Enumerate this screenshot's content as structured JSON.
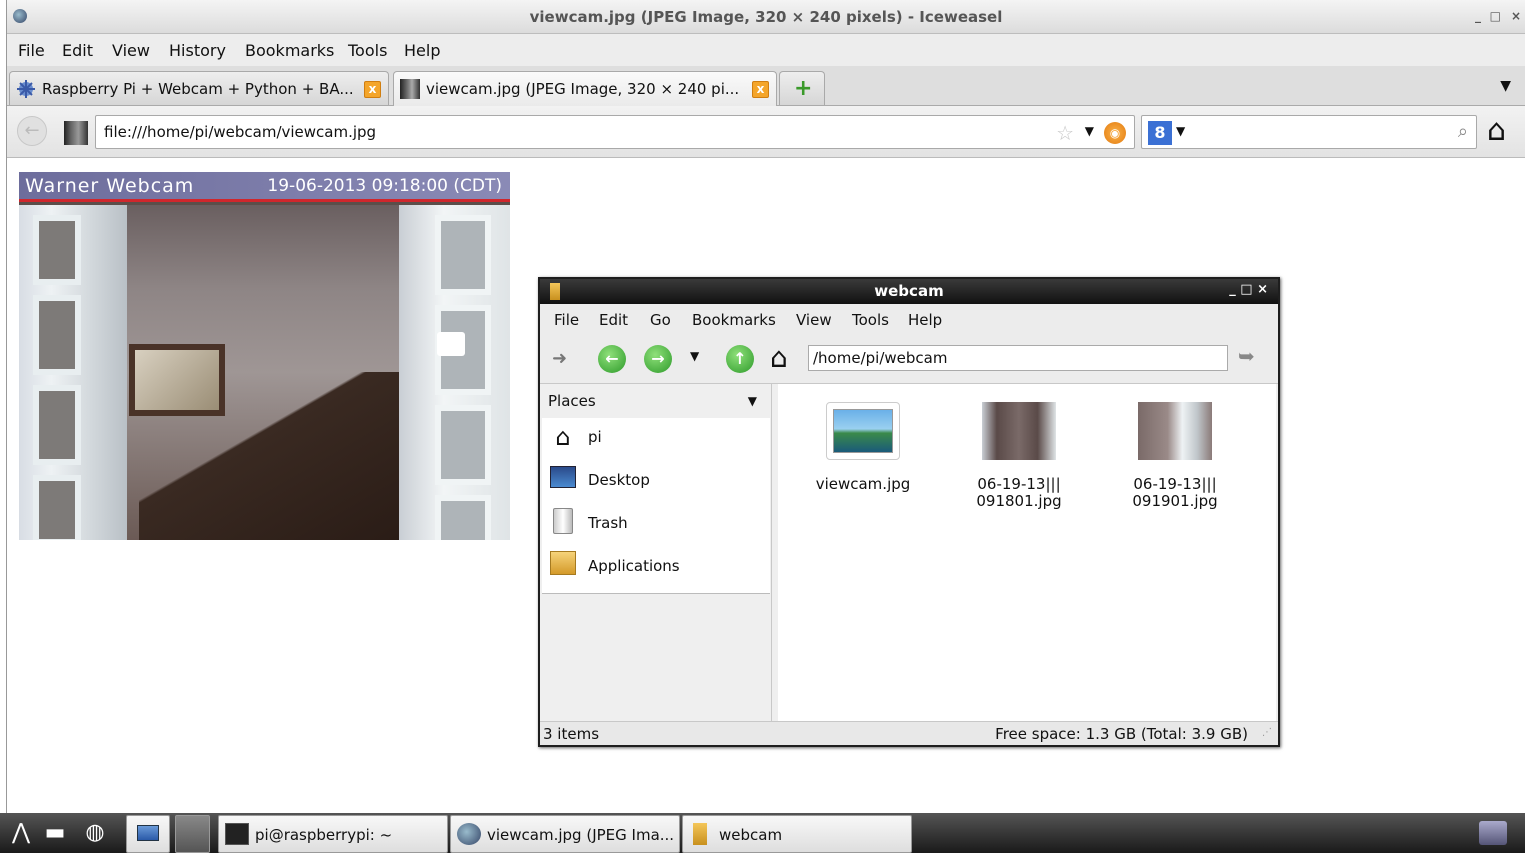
{
  "window": {
    "title": "viewcam.jpg (JPEG Image, 320 × 240 pixels) - Iceweasel",
    "min": "_",
    "max": "□",
    "close": "×"
  },
  "menubar": {
    "file": "File",
    "edit": "Edit",
    "view": "View",
    "history": "History",
    "bookmarks": "Bookmarks",
    "tools": "Tools",
    "help": "Help"
  },
  "tabs": [
    {
      "label": "Raspberry Pi + Webcam + Python + BA...",
      "close": "x"
    },
    {
      "label": "viewcam.jpg (JPEG Image, 320 × 240 pi...",
      "close": "x"
    }
  ],
  "newtab": "+",
  "tablist": "▼",
  "navbar": {
    "back": "←",
    "url": "file:///home/pi/webcam/viewcam.jpg",
    "star": "☆",
    "url_drop": "▼",
    "search_engine": "8",
    "search_drop": "▼",
    "home": "⌂"
  },
  "image": {
    "overlay_title": "Warner Webcam",
    "overlay_date": "19-06-2013 09:18:00 (CDT)"
  },
  "filemanager": {
    "title": "webcam",
    "controls": "_ □ ×",
    "menu": {
      "file": "File",
      "edit": "Edit",
      "go": "Go",
      "bookmarks": "Bookmarks",
      "view": "View",
      "tools": "Tools",
      "help": "Help"
    },
    "path": "/home/pi/webcam",
    "places_label": "Places",
    "places": [
      {
        "label": "pi",
        "icon": "home-icon"
      },
      {
        "label": "Desktop",
        "icon": "desktop-icon"
      },
      {
        "label": "Trash",
        "icon": "trash-icon"
      },
      {
        "label": "Applications",
        "icon": "applications-icon"
      }
    ],
    "files": [
      {
        "line1": "viewcam.jpg",
        "line2": ""
      },
      {
        "line1": "06-19-13|||",
        "line2": "091801.jpg"
      },
      {
        "line1": "06-19-13|||",
        "line2": "091901.jpg"
      }
    ],
    "status_left": "3 items",
    "status_right": "Free space: 1.3 GB (Total: 3.9 GB)"
  },
  "taskbar": {
    "items": [
      {
        "label": "pi@raspberrypi: ~"
      },
      {
        "label": "viewcam.jpg (JPEG Ima..."
      },
      {
        "label": "webcam"
      }
    ]
  }
}
